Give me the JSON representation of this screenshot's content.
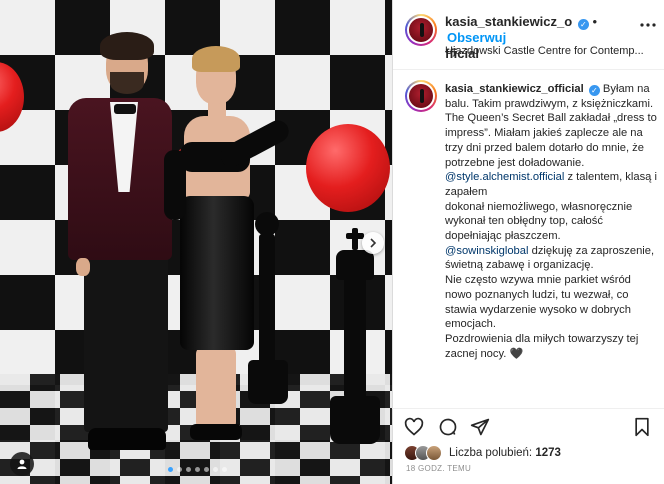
{
  "post": {
    "username": "kasia_stankiewicz_official",
    "username_line1": "kasia_stankiewicz_o",
    "username_line2": "fficial",
    "follow_label": "Obserwuj",
    "separator": "•",
    "location": "Ujazdowski Castle Centre for Contemp...",
    "more_icon": "more-horizontal-icon"
  },
  "caption": {
    "line_intro": "Byłam na balu. Takim prawdziwym, z księżniczkami.",
    "para1": "The Queen’s Secret Ball zakładał „dress to impress”. Miałam jakieś zaplecze ale na trzy dni przed balem dotarło do mnie, że potrzebne jest doładowanie.",
    "mention1": "@style.alchemist.official",
    "para2a": " z talentem, klasą i zapałem",
    "para2b": "dokonał niemożliwego, własnoręcznie wykonał ten obłędny top, całość dopełniając płaszczem.",
    "mention2": "@sowinskiglobal",
    "para3": " dziękuję za zaproszenie, świetną zabawę i organizację.",
    "para4": "Nie często wzywa mnie parkiet wśród nowo poznanych ludzi, tu wezwał, co stawia wydarzenie wysoko w dobrych emocjach.",
    "para5": "Pozdrowienia dla miłych towarzyszy tej zacnej nocy.",
    "heart": "🖤"
  },
  "actions": {
    "like_icon": "heart-icon",
    "comment_icon": "comment-icon",
    "share_icon": "send-icon",
    "save_icon": "bookmark-icon"
  },
  "likes": {
    "label": "Liczba polubień:",
    "count": "1273"
  },
  "timestamp": "18 GODZ. TEMU",
  "carousel": {
    "next_icon": "chevron-right-icon",
    "dot_count": 7,
    "active_index": 0
  },
  "colors": {
    "accent": "#0095f6",
    "verified": "#3897f0",
    "mention": "#00376b",
    "balloon": "#e41e1e"
  }
}
